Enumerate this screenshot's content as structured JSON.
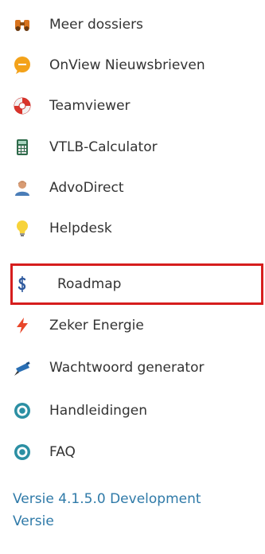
{
  "menu": {
    "items": [
      {
        "label": "Meer dossiers",
        "icon": "binoculars-icon"
      },
      {
        "label": "OnView Nieuwsbrieven",
        "icon": "chat-bubble-icon"
      },
      {
        "label": "Teamviewer",
        "icon": "lifebuoy-icon"
      },
      {
        "label": "VTLB-Calculator",
        "icon": "calculator-icon"
      },
      {
        "label": "AdvoDirect",
        "icon": "user-icon"
      },
      {
        "label": "Helpdesk",
        "icon": "lightbulb-icon"
      },
      {
        "label": "Roadmap",
        "icon": "dollar-icon"
      },
      {
        "label": "Zeker Energie",
        "icon": "lightning-icon"
      },
      {
        "label": "Wachtwoord generator",
        "icon": "camera-icon"
      },
      {
        "label": "Handleidingen",
        "icon": "target-icon"
      },
      {
        "label": "FAQ",
        "icon": "target-icon"
      }
    ],
    "highlighted_item": "Roadmap"
  },
  "footer": {
    "version_line1": "Versie 4.1.5.0 Development",
    "version_line2": "Versie"
  },
  "colors": {
    "text": "#333333",
    "link": "#2f7aa8",
    "highlight_border": "#d61e1e"
  }
}
